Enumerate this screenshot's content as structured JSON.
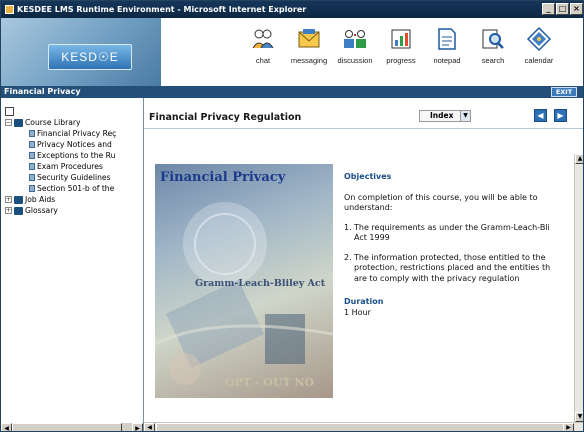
{
  "window": {
    "title": "KESDEE LMS Runtime Environment - Microsoft Internet Explorer",
    "controls": [
      "_",
      "□",
      "×"
    ]
  },
  "banner": {
    "logo_text": "KESD☉E",
    "nav": [
      {
        "label": "chat",
        "icon": "chat-icon"
      },
      {
        "label": "messaging",
        "icon": "envelope-icon"
      },
      {
        "label": "discussion",
        "icon": "discussion-icon"
      },
      {
        "label": "progress",
        "icon": "progress-icon"
      },
      {
        "label": "notepad",
        "icon": "notepad-icon"
      },
      {
        "label": "search",
        "icon": "search-icon"
      },
      {
        "label": "calendar",
        "icon": "calendar-icon"
      }
    ]
  },
  "section": {
    "title": "Financial Privacy",
    "exit_label": "EXIT"
  },
  "tree": {
    "root": "Course Library",
    "items": [
      "Financial Privacy Reç",
      "Privacy Notices and",
      "Exceptions to the Ru",
      "Exam Procedures",
      "Security Guidelines",
      "Section 501-b of the"
    ],
    "job_aids": "Job Aids",
    "glossary": "Glossary"
  },
  "content": {
    "page_title": "Financial Privacy Regulation",
    "index_label": "Index",
    "image_text": {
      "heading": "Financial Privacy",
      "act": "Gramm-Leach-Bliley Act",
      "optout": "OPT - OUT NO"
    },
    "objectives_heading": "Objectives",
    "intro_line1": "On completion of this course, you will be able to",
    "intro_line2": "understand:",
    "objectives": [
      {
        "n": "1.",
        "line1": "The requirements as under the Gramm-Leach-Bli",
        "line2": "Act 1999"
      },
      {
        "n": "2.",
        "line1": "The information protected, those entitled to the",
        "line2": "protection, restrictions placed and the entities th",
        "line3": "are to comply with the privacy regulation"
      }
    ],
    "duration_heading": "Duration",
    "duration_value": "1 Hour"
  },
  "colors": {
    "titlebar": "#0c2743",
    "sectionbar": "#244f78",
    "accent_blue": "#2c6fb5",
    "heading_blue": "#1a4f8a"
  }
}
